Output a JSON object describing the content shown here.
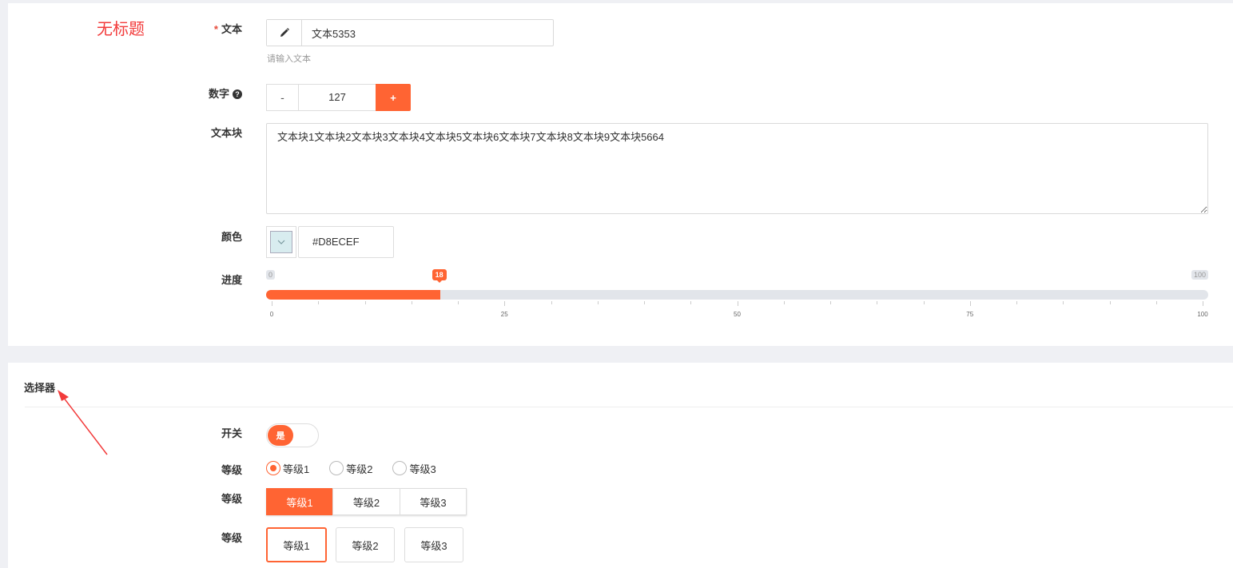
{
  "annotation_title": "无标题",
  "form": {
    "text_field": {
      "required_mark": "*",
      "label": "文本",
      "icon": "pencil-icon",
      "value": "文本5353",
      "hint": "请输入文本"
    },
    "number_field": {
      "label": "数字",
      "help_icon": "question-circle-icon",
      "minus_label": "-",
      "value": "127",
      "plus_label": "+"
    },
    "textarea_field": {
      "label": "文本块",
      "value": "文本块1文本块2文本块3文本块4文本块5文本块6文本块7文本块8文本块9文本块5664"
    },
    "color_field": {
      "label": "颜色",
      "swatch_color": "#D8ECEF",
      "value": "#D8ECEF",
      "icon": "chevron-down-icon"
    },
    "progress_field": {
      "label": "进度",
      "min_label": "0",
      "max_label": "100",
      "value": 18,
      "value_label": "18",
      "tick_labels": [
        "0",
        "25",
        "50",
        "75",
        "100"
      ]
    }
  },
  "selector_section": {
    "title": "选择器",
    "switch_field": {
      "label": "开关",
      "on_label": "是"
    },
    "radio_field": {
      "label": "等级",
      "options": [
        "等级1",
        "等级2",
        "等级3"
      ],
      "selected": 0
    },
    "segmented_field": {
      "label": "等级",
      "options": [
        "等级1",
        "等级2",
        "等级3"
      ],
      "selected": 0
    },
    "card_field": {
      "label": "等级",
      "options": [
        "等级1",
        "等级2",
        "等级3"
      ],
      "selected": 0
    }
  },
  "colors": {
    "accent": "#ff6433",
    "annotation": "#f23b3b"
  }
}
